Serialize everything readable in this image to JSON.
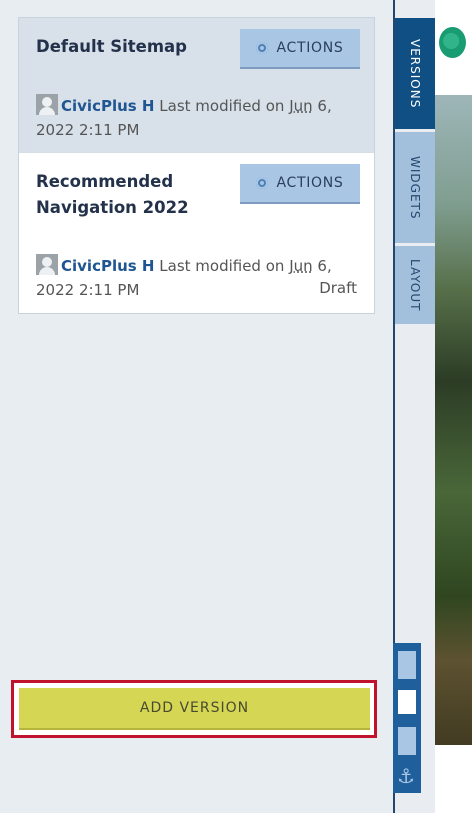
{
  "versions": [
    {
      "title": "Default Sitemap",
      "actions_label": "ACTIONS",
      "user": "CivicPlus H",
      "modified_prefix": "Last modified on",
      "month": "Jun",
      "date_rest": "6,",
      "date_line2": "2022 2:11 PM",
      "status": ""
    },
    {
      "title": "Recommended Navigation 2022",
      "actions_label": "ACTIONS",
      "user": "CivicPlus H",
      "modified_prefix": "Last modified on",
      "month": "Jun",
      "date_rest": "6,",
      "date_line2": "2022 2:11 PM",
      "status": "Draft"
    }
  ],
  "add_button_label": "ADD VERSION",
  "tabs": [
    {
      "label": "VERSIONS"
    },
    {
      "label": "WIDGETS"
    },
    {
      "label": "LAYOUT"
    }
  ],
  "icons": {
    "gear": "gear-icon",
    "avatar": "user-avatar-icon",
    "logo": "site-logo-icon",
    "anchor": "anchor-icon"
  },
  "colors": {
    "active_tab": "#104f84",
    "inactive_tab": "#a2bfdc",
    "actions_button": "#a9c6e4",
    "add_button": "#d6d655",
    "highlight_border": "#c0122d"
  }
}
